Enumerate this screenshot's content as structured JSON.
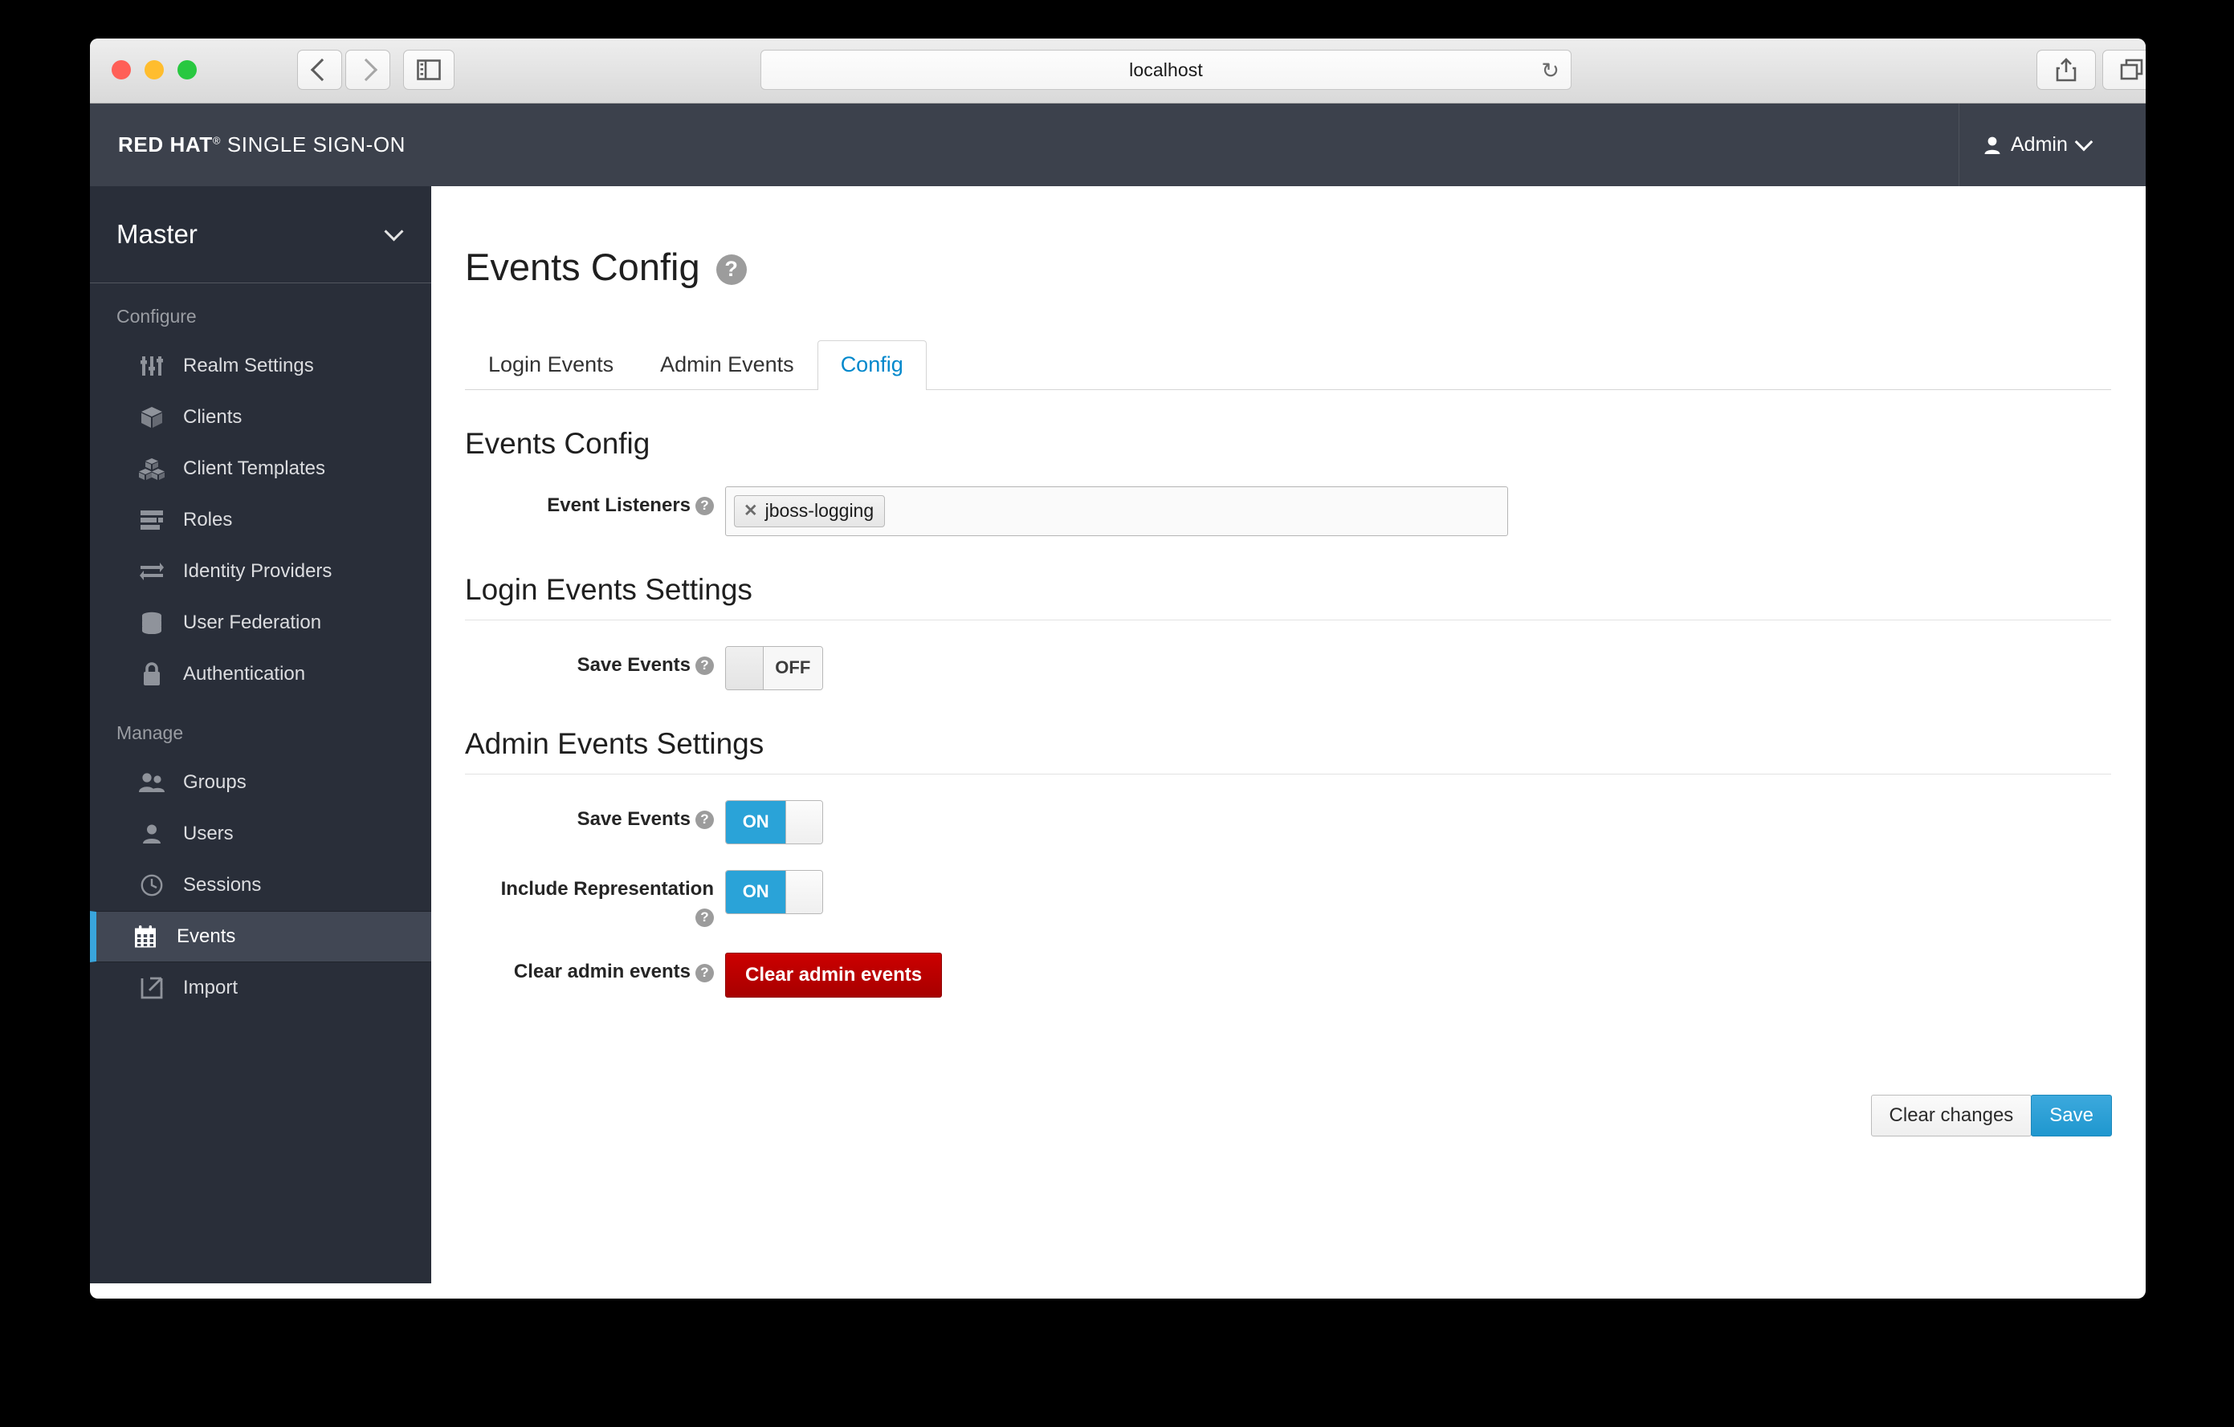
{
  "browser": {
    "url": "localhost",
    "reload_icon": "reload-icon",
    "back_icon": "chevron-left-icon",
    "forward_icon": "chevron-right-icon",
    "sidebar_icon": "sidebar-toggle-icon",
    "share_icon": "share-icon",
    "tabs_icon": "tabs-overview-icon",
    "new_tab_label": "+"
  },
  "masthead": {
    "brand_primary": "RED HAT",
    "brand_reg": "®",
    "brand_secondary": "SINGLE SIGN-ON",
    "user_icon": "user-icon",
    "user_name": "Admin",
    "user_caret_icon": "chevron-down-icon"
  },
  "sidebar": {
    "realm": "Master",
    "realm_caret_icon": "chevron-down-icon",
    "groups": [
      {
        "title": "Configure",
        "items": [
          {
            "label": "Realm Settings",
            "icon": "sliders-icon",
            "active": false
          },
          {
            "label": "Clients",
            "icon": "cube-icon",
            "active": false
          },
          {
            "label": "Client Templates",
            "icon": "cubes-icon",
            "active": false
          },
          {
            "label": "Roles",
            "icon": "list-icon",
            "active": false
          },
          {
            "label": "Identity Providers",
            "icon": "exchange-icon",
            "active": false
          },
          {
            "label": "User Federation",
            "icon": "database-icon",
            "active": false
          },
          {
            "label": "Authentication",
            "icon": "lock-icon",
            "active": false
          }
        ]
      },
      {
        "title": "Manage",
        "items": [
          {
            "label": "Groups",
            "icon": "users-icon",
            "active": false
          },
          {
            "label": "Users",
            "icon": "user-icon",
            "active": false
          },
          {
            "label": "Sessions",
            "icon": "clock-icon",
            "active": false
          },
          {
            "label": "Events",
            "icon": "calendar-icon",
            "active": true
          },
          {
            "label": "Import",
            "icon": "import-icon",
            "active": false
          }
        ]
      }
    ]
  },
  "main": {
    "page_title": "Events Config",
    "page_help_icon": "help-circle-icon",
    "tabs": [
      {
        "label": "Login Events",
        "active": false
      },
      {
        "label": "Admin Events",
        "active": false
      },
      {
        "label": "Config",
        "active": true
      }
    ],
    "events_config": {
      "heading": "Events Config",
      "event_listeners": {
        "label": "Event Listeners",
        "help_icon": "help-circle-icon",
        "chips": [
          {
            "text": "jboss-logging",
            "close_icon": "close-icon"
          }
        ]
      }
    },
    "login_events_settings": {
      "heading": "Login Events Settings",
      "save_events": {
        "label": "Save Events",
        "help_icon": "help-circle-icon",
        "state": "OFF",
        "on_label": "ON",
        "off_label": "OFF"
      }
    },
    "admin_events_settings": {
      "heading": "Admin Events Settings",
      "save_events": {
        "label": "Save Events",
        "help_icon": "help-circle-icon",
        "state": "ON",
        "on_label": "ON",
        "off_label": "OFF"
      },
      "include_representation": {
        "label": "Include Representation",
        "help_icon": "help-circle-icon",
        "state": "ON",
        "on_label": "ON",
        "off_label": "OFF"
      },
      "clear_admin_events": {
        "label": "Clear admin events",
        "help_icon": "help-circle-icon",
        "button_label": "Clear admin events"
      }
    },
    "actions": {
      "clear_changes_label": "Clear changes",
      "save_label": "Save"
    }
  },
  "colors": {
    "masthead_bg": "#3c414c",
    "sidebar_bg": "#292e39",
    "accent_blue": "#0088cc",
    "switch_on": "#2aa3d8",
    "danger_red": "#cc0000",
    "active_border": "#39a5dc"
  }
}
